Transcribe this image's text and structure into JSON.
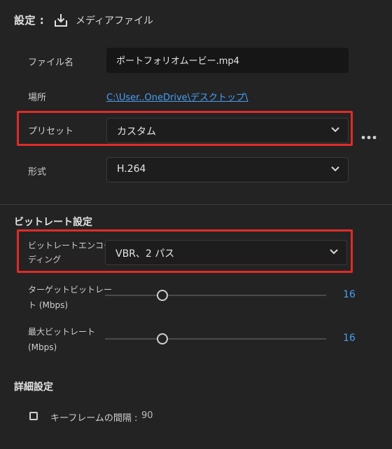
{
  "header": {
    "title": "設定 :",
    "label": "メディアファイル",
    "icon": "download-icon"
  },
  "fields": {
    "filename_label": "ファイル名",
    "filename_value": "ポートフォリオムービー.mp4",
    "location_label": "場所",
    "location_value": "C:\\User..OneDrive\\デスクトップ\\",
    "preset_label": "プリセット",
    "preset_value": "カスタム",
    "format_label": "形式",
    "format_value": "H.264"
  },
  "bitrate": {
    "section_title": "ビットレート設定",
    "encoding_label_line1": "ビットレートエンコー",
    "encoding_label_line2": "ディング",
    "encoding_value": "VBR、2 パス",
    "target_label_line1": "ターゲットビットレー",
    "target_label_line2": "ト (Mbps)",
    "target_value": "16",
    "target_level": 0.26,
    "max_label_line1": "最大ビットレート",
    "max_label_line2": "(Mbps)",
    "max_value": "16",
    "max_level": 0.26
  },
  "advanced": {
    "section_title": "詳細設定",
    "keyframe_label": "キーフレームの間隔 :",
    "keyframe_value": "90",
    "keyframe_checked": false
  },
  "colors": {
    "accent": "#4a9ef3",
    "highlight": "#e02b2b",
    "background": "#232323"
  }
}
